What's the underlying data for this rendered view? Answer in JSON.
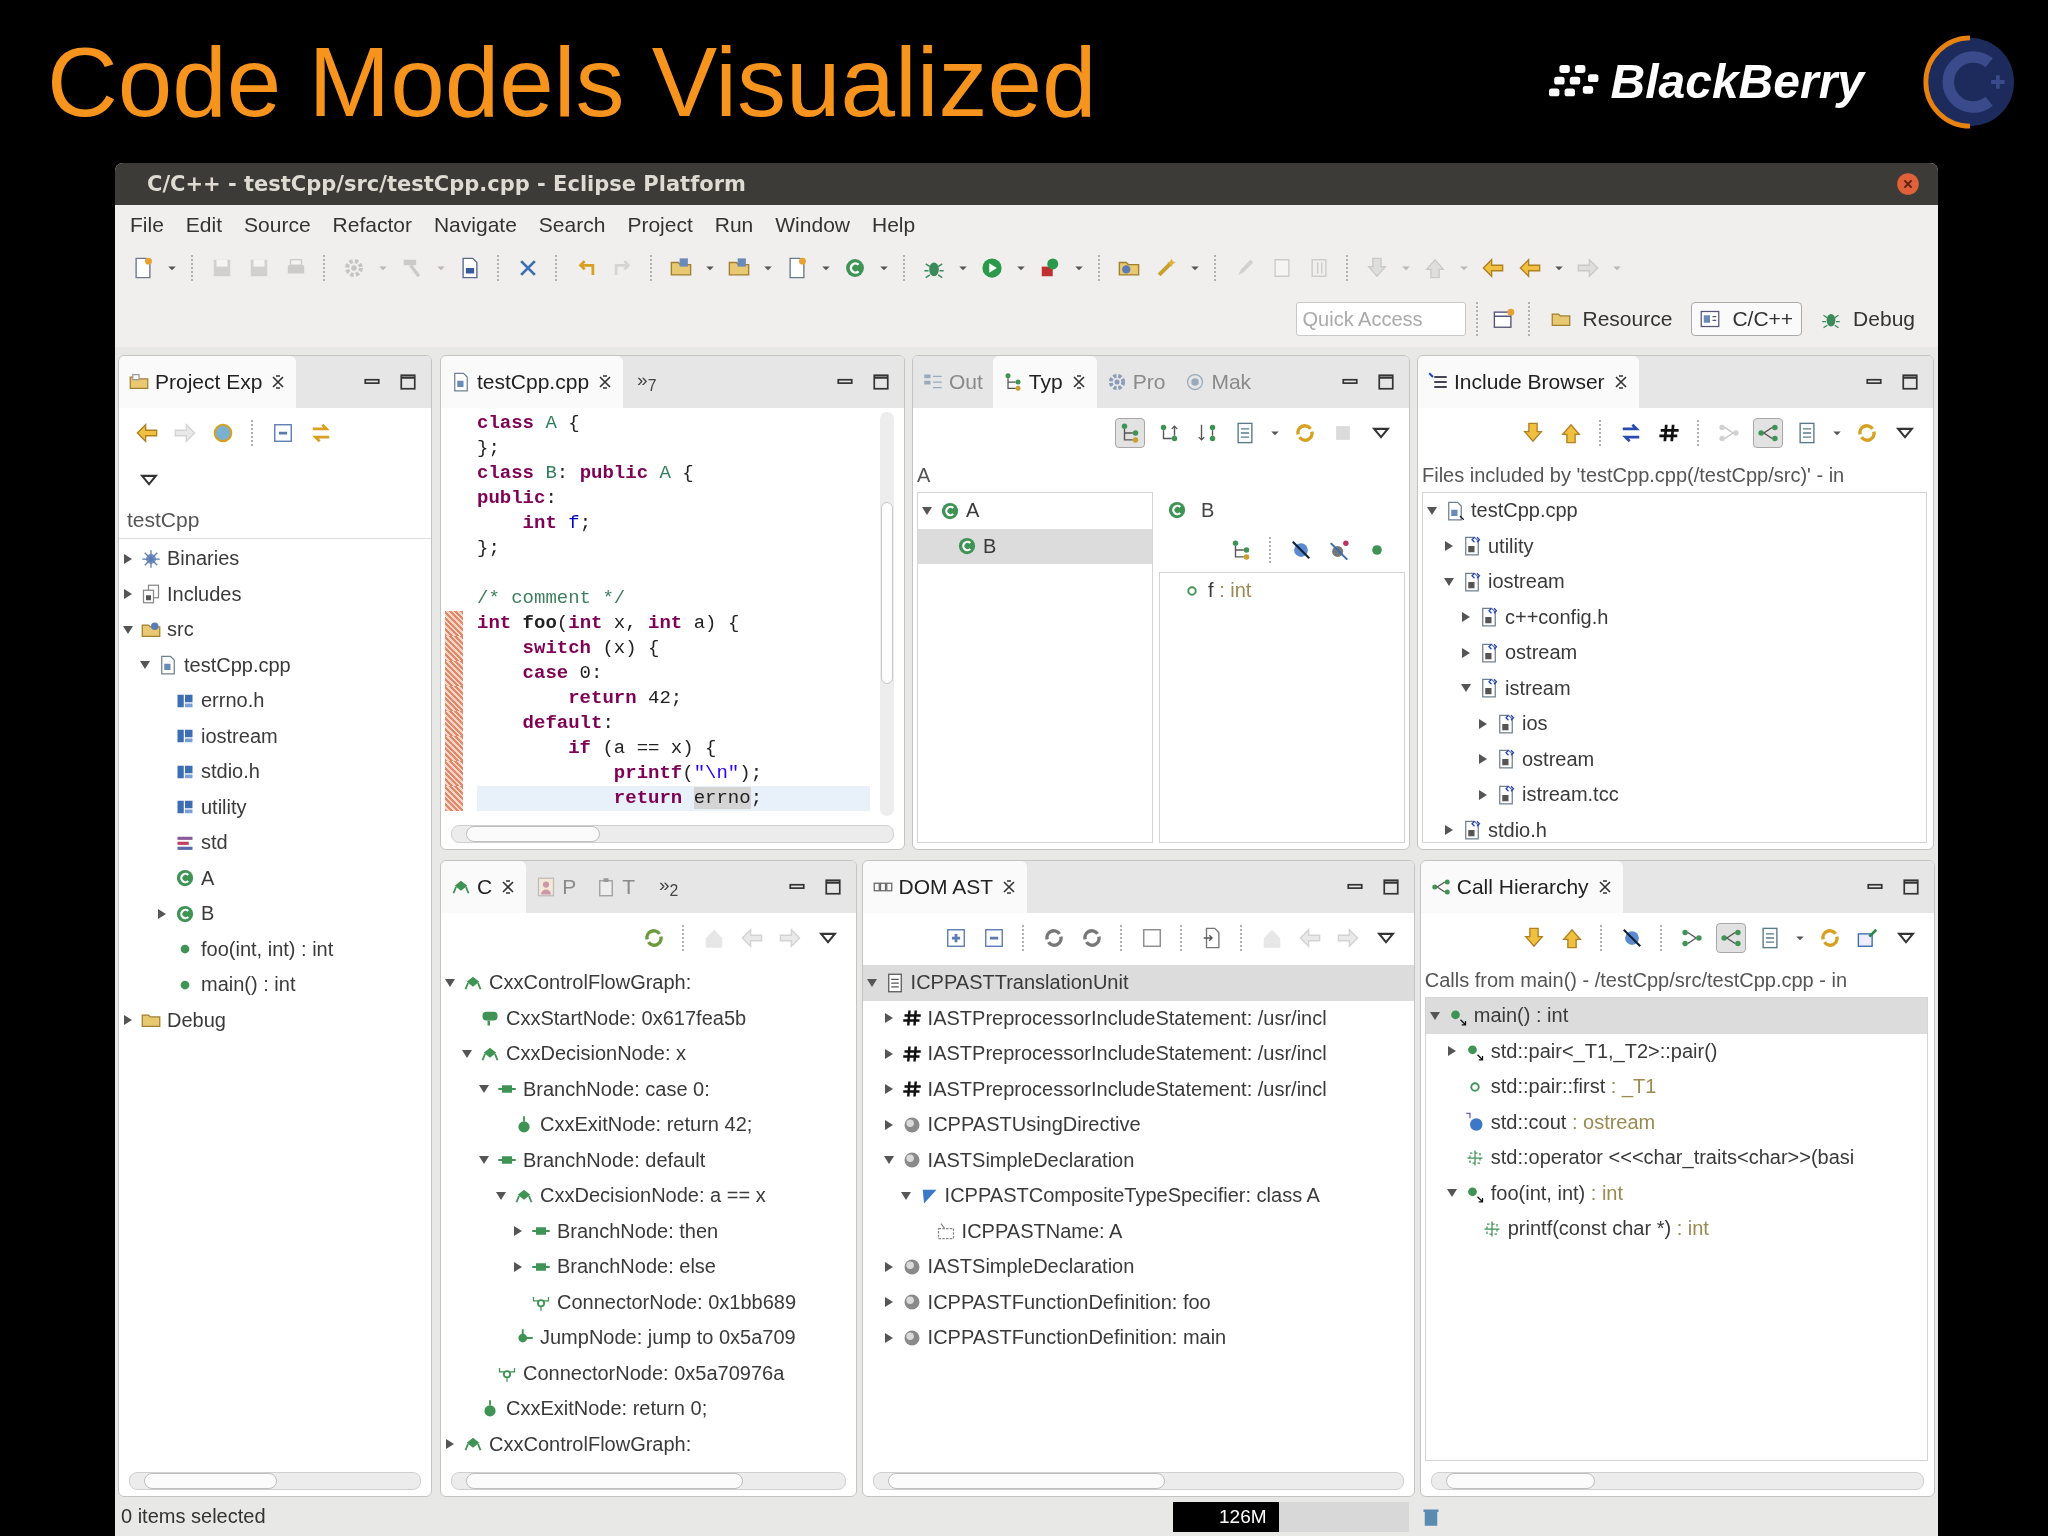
{
  "slide": {
    "title": "Code Models Visualized",
    "brand": "BlackBerry"
  },
  "window": {
    "title": "C/C++ - testCpp/src/testCpp.cpp - Eclipse Platform"
  },
  "menu": [
    "File",
    "Edit",
    "Source",
    "Refactor",
    "Navigate",
    "Search",
    "Project",
    "Run",
    "Window",
    "Help"
  ],
  "toolbar": [
    {
      "kind": "new",
      "disabled": false
    },
    {
      "kind": "drop",
      "disabled": false
    },
    {
      "kind": "sep"
    },
    {
      "kind": "save",
      "disabled": true
    },
    {
      "kind": "save",
      "disabled": true
    },
    {
      "kind": "print",
      "disabled": true
    },
    {
      "kind": "sep"
    },
    {
      "kind": "gear",
      "disabled": true
    },
    {
      "kind": "drop",
      "disabled": true
    },
    {
      "kind": "hammer",
      "disabled": true
    },
    {
      "kind": "drop",
      "disabled": true
    },
    {
      "kind": "binary",
      "disabled": false
    },
    {
      "kind": "sep"
    },
    {
      "kind": "xmark",
      "disabled": false
    },
    {
      "kind": "sep"
    },
    {
      "kind": "undo",
      "disabled": false
    },
    {
      "kind": "redo",
      "disabled": true
    },
    {
      "kind": "sep"
    },
    {
      "kind": "cfolder",
      "disabled": false
    },
    {
      "kind": "drop",
      "disabled": false
    },
    {
      "kind": "cfolder",
      "disabled": false
    },
    {
      "kind": "drop",
      "disabled": false
    },
    {
      "kind": "new",
      "disabled": false
    },
    {
      "kind": "drop",
      "disabled": false
    },
    {
      "kind": "class",
      "disabled": false
    },
    {
      "kind": "drop",
      "disabled": false
    },
    {
      "kind": "sep"
    },
    {
      "kind": "bug",
      "disabled": false
    },
    {
      "kind": "drop",
      "disabled": false
    },
    {
      "kind": "run",
      "disabled": false
    },
    {
      "kind": "drop",
      "disabled": false
    },
    {
      "kind": "ext",
      "disabled": false
    },
    {
      "kind": "drop",
      "disabled": false
    },
    {
      "kind": "sep"
    },
    {
      "kind": "open",
      "disabled": false
    },
    {
      "kind": "wand",
      "disabled": false
    },
    {
      "kind": "drop",
      "disabled": false
    },
    {
      "kind": "sep"
    },
    {
      "kind": "pen",
      "disabled": true
    },
    {
      "kind": "doc",
      "disabled": true
    },
    {
      "kind": "para",
      "disabled": true
    },
    {
      "kind": "sep"
    },
    {
      "kind": "down",
      "disabled": true
    },
    {
      "kind": "drop",
      "disabled": true
    },
    {
      "kind": "up",
      "disabled": true
    },
    {
      "kind": "drop",
      "disabled": true
    },
    {
      "kind": "back",
      "disabled": false
    },
    {
      "kind": "back",
      "disabled": false
    },
    {
      "kind": "drop",
      "disabled": false
    },
    {
      "kind": "forward",
      "disabled": true
    },
    {
      "kind": "drop",
      "disabled": true
    }
  ],
  "perspective_bar": {
    "quick_access": {
      "placeholder": "Quick Access"
    },
    "perspectives": [
      {
        "kind": "resource",
        "label": "Resource",
        "selected": false
      },
      {
        "kind": "cpp",
        "label": "C/C++",
        "selected": true
      },
      {
        "kind": "debug",
        "label": "Debug",
        "selected": false
      }
    ]
  },
  "project_explorer": {
    "tabs": [
      {
        "kind": "explorer",
        "label": "Project Exp",
        "selected": true
      }
    ],
    "toolbar": [
      {
        "kind": "back",
        "disabled": false
      },
      {
        "kind": "forward",
        "disabled": true
      },
      {
        "kind": "golink",
        "disabled": false
      },
      {
        "kind": "sep"
      },
      {
        "kind": "collapse",
        "disabled": false
      },
      {
        "kind": "link",
        "disabled": false
      }
    ],
    "root": "testCpp",
    "tree": [
      {
        "kind": "binaries",
        "label": "Binaries",
        "expanded": false,
        "selected": false
      },
      {
        "kind": "includes",
        "label": "Includes",
        "expanded": false,
        "selected": false
      },
      {
        "kind": "srcfolder",
        "label": "src",
        "expanded": true,
        "selected": false,
        "children": [
          {
            "kind": "cfile",
            "label": "testCpp.cpp",
            "expanded": true,
            "selected": false,
            "children": [
              {
                "kind": "header",
                "label": "errno.h",
                "selected": false
              },
              {
                "kind": "header",
                "label": "iostream",
                "selected": false
              },
              {
                "kind": "header",
                "label": "stdio.h",
                "selected": false
              },
              {
                "kind": "header",
                "label": "utility",
                "selected": false
              },
              {
                "kind": "namespace",
                "label": "std",
                "selected": false
              },
              {
                "kind": "class",
                "label": "A",
                "selected": false
              },
              {
                "kind": "class",
                "label": "B",
                "expanded": false,
                "selected": false
              },
              {
                "kind": "method",
                "label": "foo(int, int) : int",
                "selected": false
              },
              {
                "kind": "method",
                "label": "main() : int",
                "selected": false
              }
            ]
          }
        ]
      },
      {
        "kind": "folder",
        "label": "Debug",
        "expanded": false,
        "selected": false
      }
    ]
  },
  "editor": {
    "tabs": [
      {
        "kind": "cfile",
        "label": "testCpp.cpp",
        "selected": true
      }
    ],
    "overflow": "»$_{7}$",
    "lines": [
      {
        "changed": false,
        "current": false,
        "tokens": [
          {
            "kind": "kw",
            "text": "class"
          },
          {
            "kind": "type",
            "text": " A"
          },
          {
            "kind": "p",
            "text": " {"
          }
        ]
      },
      {
        "changed": false,
        "current": false,
        "tokens": [
          {
            "kind": "p",
            "text": "};"
          }
        ]
      },
      {
        "changed": false,
        "current": false,
        "tokens": [
          {
            "kind": "kw",
            "text": "class"
          },
          {
            "kind": "type",
            "text": " B"
          },
          {
            "kind": "p",
            "text": ": "
          },
          {
            "kind": "kw",
            "text": "public"
          },
          {
            "kind": "type",
            "text": " A"
          },
          {
            "kind": "p",
            "text": " {"
          }
        ]
      },
      {
        "changed": false,
        "current": false,
        "tokens": [
          {
            "kind": "kw",
            "text": "public"
          },
          {
            "kind": "p",
            "text": ":"
          }
        ]
      },
      {
        "changed": false,
        "current": false,
        "tokens": [
          {
            "kind": "kw",
            "text": "    int"
          },
          {
            "kind": "field",
            "text": " f"
          },
          {
            "kind": "p",
            "text": ";"
          }
        ]
      },
      {
        "changed": false,
        "current": false,
        "tokens": [
          {
            "kind": "p",
            "text": "};"
          }
        ]
      },
      {
        "changed": false,
        "current": false
      },
      {
        "changed": false,
        "current": false,
        "tokens": [
          {
            "kind": "cm",
            "text": "/* comment */"
          }
        ]
      },
      {
        "changed": true,
        "current": false,
        "tokens": [
          {
            "kind": "kw",
            "text": "int"
          },
          {
            "kind": "fn",
            "text": " foo"
          },
          {
            "kind": "p",
            "text": "("
          },
          {
            "kind": "kw",
            "text": "int"
          },
          {
            "kind": "p",
            "text": " x, "
          },
          {
            "kind": "kw",
            "text": "int"
          },
          {
            "kind": "p",
            "text": " a) {"
          }
        ]
      },
      {
        "changed": true,
        "current": false,
        "tokens": [
          {
            "kind": "kw",
            "text": "    switch"
          },
          {
            "kind": "p",
            "text": " (x) {"
          }
        ]
      },
      {
        "changed": true,
        "current": false,
        "tokens": [
          {
            "kind": "kw",
            "text": "    case"
          },
          {
            "kind": "p",
            "text": " 0:"
          }
        ]
      },
      {
        "changed": true,
        "current": false,
        "tokens": [
          {
            "kind": "kw",
            "text": "        return"
          },
          {
            "kind": "p",
            "text": " 42;"
          }
        ]
      },
      {
        "changed": true,
        "current": false,
        "tokens": [
          {
            "kind": "kw",
            "text": "    default"
          },
          {
            "kind": "p",
            "text": ":"
          }
        ]
      },
      {
        "changed": true,
        "current": false,
        "tokens": [
          {
            "kind": "kw",
            "text": "        if"
          },
          {
            "kind": "p",
            "text": " (a == x) {"
          }
        ]
      },
      {
        "changed": true,
        "current": false,
        "tokens": [
          {
            "kind": "kw",
            "text": "            printf"
          },
          {
            "kind": "p",
            "text": "("
          },
          {
            "kind": "str",
            "text": "\"\\n\""
          },
          {
            "kind": "p",
            "text": ");"
          }
        ]
      },
      {
        "changed": true,
        "current": true,
        "tokens": [
          {
            "kind": "kw",
            "text": "            return "
          },
          {
            "kind": "occ",
            "text": "errno"
          },
          {
            "kind": "p",
            "text": ";"
          }
        ]
      }
    ]
  },
  "type_hierarchy": {
    "tabs": [
      {
        "kind": "outline",
        "label": "Out",
        "selected": false
      },
      {
        "kind": "typ",
        "label": "Typ",
        "selected": true
      },
      {
        "kind": "pro",
        "label": "Pro",
        "selected": false
      },
      {
        "kind": "mak",
        "label": "Mak",
        "selected": false
      }
    ],
    "toolbar": [
      {
        "kind": "typ",
        "disabled": false,
        "pressed": true
      },
      {
        "kind": "superh",
        "disabled": false,
        "pressed": false
      },
      {
        "kind": "subh",
        "disabled": false,
        "pressed": false
      },
      {
        "kind": "list",
        "disabled": false,
        "pressed": false
      },
      {
        "kind": "drop",
        "disabled": false,
        "pressed": false
      },
      {
        "kind": "refresh",
        "disabled": false,
        "pressed": false
      },
      {
        "kind": "stop",
        "disabled": true,
        "pressed": false
      },
      {
        "kind": "viewmenu",
        "disabled": false,
        "pressed": false
      }
    ],
    "label": "A",
    "tree": [
      {
        "kind": "class",
        "label": "A",
        "expanded": true,
        "selected": false,
        "children": [
          {
            "kind": "class",
            "label": "B",
            "selected": true
          }
        ]
      }
    ],
    "member_header": {
      "kind": "class",
      "label": "B"
    },
    "member_toolbar": [
      {
        "kind": "typ",
        "disabled": false
      },
      {
        "kind": "sep"
      },
      {
        "kind": "hide",
        "disabled": false
      },
      {
        "kind": "static",
        "disabled": false
      },
      {
        "kind": "method",
        "disabled": false
      }
    ],
    "members": [
      {
        "kind": "field",
        "label": "f",
        "type": ": int",
        "selected": false
      }
    ]
  },
  "include_browser": {
    "tabs": [
      {
        "kind": "include",
        "label": "Include Browser",
        "selected": true
      }
    ],
    "toolbar": [
      {
        "kind": "down",
        "disabled": false,
        "pressed": false
      },
      {
        "kind": "up",
        "disabled": false,
        "pressed": false
      },
      {
        "kind": "sep"
      },
      {
        "kind": "swap",
        "disabled": false,
        "pressed": false
      },
      {
        "kind": "hash",
        "disabled": false,
        "pressed": false
      },
      {
        "kind": "sep"
      },
      {
        "kind": "callee",
        "disabled": true,
        "pressed": false
      },
      {
        "kind": "caller",
        "disabled": false,
        "pressed": true
      },
      {
        "kind": "list",
        "disabled": false,
        "pressed": false
      },
      {
        "kind": "drop",
        "disabled": false,
        "pressed": false
      },
      {
        "kind": "refresh",
        "disabled": false,
        "pressed": false
      },
      {
        "kind": "viewmenu",
        "disabled": false,
        "pressed": false
      }
    ],
    "label": "Files included by 'testCpp.cpp(/testCpp/src)' - in",
    "tree": [
      {
        "kind": "cinc",
        "label": "testCpp.cpp",
        "expanded": true,
        "selected": false,
        "children": [
          {
            "kind": "hfile",
            "label": "utility",
            "expanded": false,
            "selected": false
          },
          {
            "kind": "hfile",
            "label": "iostream",
            "expanded": true,
            "selected": false,
            "children": [
              {
                "kind": "hfile",
                "label": "c++config.h",
                "expanded": false,
                "selected": false
              },
              {
                "kind": "hfile",
                "label": "ostream",
                "expanded": false,
                "selected": false
              },
              {
                "kind": "hfile",
                "label": "istream",
                "expanded": true,
                "selected": false,
                "children": [
                  {
                    "kind": "hfile",
                    "label": "ios",
                    "expanded": false,
                    "selected": false
                  },
                  {
                    "kind": "hfile",
                    "label": "ostream",
                    "expanded": false,
                    "selected": false
                  },
                  {
                    "kind": "hfile",
                    "label": "istream.tcc",
                    "expanded": false,
                    "selected": false
                  }
                ]
              }
            ]
          },
          {
            "kind": "hfile",
            "label": "stdio.h",
            "expanded": false,
            "selected": false
          }
        ]
      }
    ]
  },
  "cfg_view": {
    "tabs": [
      {
        "kind": "flow",
        "label": "C",
        "selected": true
      },
      {
        "kind": "person",
        "label": "P",
        "selected": false
      },
      {
        "kind": "task",
        "label": "T",
        "selected": false
      }
    ],
    "overflow": "»$_{2}$",
    "toolbar": [
      {
        "kind": "refresh3",
        "disabled": false
      },
      {
        "kind": "sep"
      },
      {
        "kind": "home",
        "disabled": true
      },
      {
        "kind": "back",
        "disabled": true
      },
      {
        "kind": "forward",
        "disabled": true
      },
      {
        "kind": "viewmenu",
        "disabled": false
      }
    ],
    "tree": [
      {
        "kind": "flow",
        "label": "CxxControlFlowGraph:",
        "expanded": true,
        "selected": false,
        "children": [
          {
            "kind": "start",
            "label": "CxxStartNode: 0x617fea5b",
            "selected": false
          },
          {
            "kind": "flow",
            "label": "CxxDecisionNode: x",
            "expanded": true,
            "selected": false,
            "children": [
              {
                "kind": "branch",
                "label": "BranchNode: case 0:",
                "expanded": true,
                "selected": false,
                "children": [
                  {
                    "kind": "exit",
                    "label": "CxxExitNode: return 42;",
                    "selected": false
                  }
                ]
              },
              {
                "kind": "branch",
                "label": "BranchNode: default",
                "expanded": true,
                "selected": false,
                "children": [
                  {
                    "kind": "flow",
                    "label": "CxxDecisionNode: a == x",
                    "expanded": true,
                    "selected": false,
                    "children": [
                      {
                        "kind": "branch",
                        "label": "BranchNode: then",
                        "expanded": false,
                        "selected": false
                      },
                      {
                        "kind": "branch",
                        "label": "BranchNode: else",
                        "expanded": false,
                        "selected": false
                      },
                      {
                        "kind": "connector",
                        "label": "ConnectorNode: 0x1bb689",
                        "selected": false
                      }
                    ]
                  },
                  {
                    "kind": "jump",
                    "label": "JumpNode: jump to 0x5a709",
                    "selected": false
                  }
                ]
              },
              {
                "kind": "connector",
                "label": "ConnectorNode: 0x5a70976a",
                "selected": false
              }
            ]
          },
          {
            "kind": "exit",
            "label": "CxxExitNode: return 0;",
            "selected": false
          }
        ]
      },
      {
        "kind": "flow",
        "label": "CxxControlFlowGraph:",
        "expanded": false,
        "selected": false
      }
    ]
  },
  "dom_ast": {
    "tabs": [
      {
        "kind": "dom",
        "label": "DOM AST",
        "selected": true
      }
    ],
    "toolbar": [
      {
        "kind": "expand",
        "disabled": false
      },
      {
        "kind": "collapse",
        "disabled": false
      },
      {
        "kind": "sep"
      },
      {
        "kind": "refresh2",
        "disabled": false
      },
      {
        "kind": "refresh2",
        "disabled": false
      },
      {
        "kind": "sep"
      },
      {
        "kind": "square",
        "disabled": false
      },
      {
        "kind": "sep"
      },
      {
        "kind": "import",
        "disabled": false
      },
      {
        "kind": "sep"
      },
      {
        "kind": "home",
        "disabled": true
      },
      {
        "kind": "back",
        "disabled": true
      },
      {
        "kind": "forward",
        "disabled": true
      },
      {
        "kind": "viewmenu",
        "disabled": false
      }
    ],
    "tree": [
      {
        "kind": "tu",
        "label": "ICPPASTTranslationUnit",
        "expanded": true,
        "selected": true,
        "children": [
          {
            "kind": "hash",
            "label": "IASTPreprocessorIncludeStatement: /usr/incl",
            "expanded": false,
            "selected": false
          },
          {
            "kind": "hash",
            "label": "IASTPreprocessorIncludeStatement: /usr/incl",
            "expanded": false,
            "selected": false
          },
          {
            "kind": "hash",
            "label": "IASTPreprocessorIncludeStatement: /usr/incl",
            "expanded": false,
            "selected": false
          },
          {
            "kind": "sphere",
            "label": "ICPPASTUsingDirective",
            "expanded": false,
            "selected": false
          },
          {
            "kind": "sphere",
            "label": "IASTSimpleDeclaration",
            "expanded": true,
            "selected": false,
            "children": [
              {
                "kind": "composite",
                "label": "ICPPASTCompositeTypeSpecifier: class A",
                "expanded": true,
                "selected": false,
                "children": [
                  {
                    "kind": "astname",
                    "label": "ICPPASTName: A",
                    "selected": false
                  }
                ]
              }
            ]
          },
          {
            "kind": "sphere",
            "label": "IASTSimpleDeclaration",
            "expanded": false,
            "selected": false
          },
          {
            "kind": "sphere",
            "label": "ICPPASTFunctionDefinition: foo",
            "expanded": false,
            "selected": false
          },
          {
            "kind": "sphere",
            "label": "ICPPASTFunctionDefinition: main",
            "expanded": false,
            "selected": false
          }
        ]
      }
    ]
  },
  "call_hierarchy": {
    "tabs": [
      {
        "kind": "callh",
        "label": "Call Hierarchy",
        "selected": true
      }
    ],
    "toolbar": [
      {
        "kind": "down",
        "disabled": false,
        "pressed": false
      },
      {
        "kind": "up",
        "disabled": false,
        "pressed": false
      },
      {
        "kind": "sep"
      },
      {
        "kind": "hide",
        "disabled": false,
        "pressed": false
      },
      {
        "kind": "sep"
      },
      {
        "kind": "callee",
        "disabled": false,
        "pressed": false
      },
      {
        "kind": "caller",
        "disabled": false,
        "pressed": true
      },
      {
        "kind": "list",
        "disabled": false,
        "pressed": false
      },
      {
        "kind": "drop",
        "disabled": false,
        "pressed": false
      },
      {
        "kind": "refresh",
        "disabled": false,
        "pressed": false
      },
      {
        "kind": "pinview",
        "disabled": false,
        "pressed": false
      },
      {
        "kind": "viewmenu",
        "disabled": false,
        "pressed": false
      }
    ],
    "label": "Calls from main() - /testCpp/src/testCpp.cpp - in",
    "tree": [
      {
        "kind": "call",
        "label": "main() : int",
        "expanded": true,
        "selected": true,
        "children": [
          {
            "kind": "call",
            "label": "std::pair<_T1,_T2>::pair()",
            "expanded": false,
            "selected": false
          },
          {
            "kind": "field",
            "label": "std::pair::first",
            "type": ": _T1",
            "selected": false
          },
          {
            "kind": "variable",
            "label": "std::cout",
            "type": ": ostream",
            "selected": false
          },
          {
            "kind": "function",
            "label": "std::operator <<<char_traits<char>>(basi",
            "selected": false
          },
          {
            "kind": "call",
            "label": "foo(int, int)",
            "type": ": int",
            "expanded": true,
            "selected": false,
            "children": [
              {
                "kind": "function",
                "label": "printf(const char *)",
                "type": ": int",
                "selected": false
              }
            ]
          }
        ]
      }
    ]
  },
  "status_bar": {
    "message": "0 items selected",
    "heap": {
      "reading": "126M",
      "level": 0.45
    }
  }
}
